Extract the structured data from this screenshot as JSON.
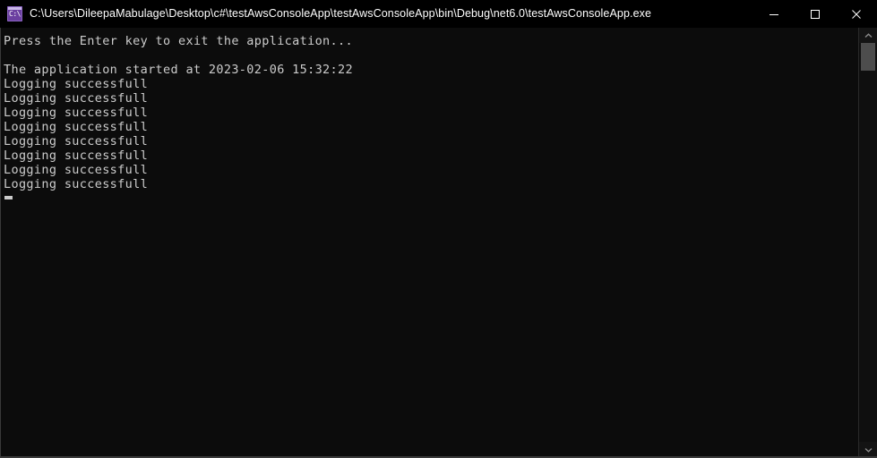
{
  "window": {
    "title": "C:\\Users\\DileepaMabulage\\Desktop\\c#\\testAwsConsoleApp\\testAwsConsoleApp\\bin\\Debug\\net6.0\\testAwsConsoleApp.exe",
    "icon_name": "console-app-icon",
    "icon_prompt_text": "C:\\",
    "background_color": "#0c0c0c",
    "titlebar_color": "#000000",
    "text_color": "#cccccc"
  },
  "controls": {
    "minimize_label": "Minimize",
    "maximize_label": "Maximize",
    "close_label": "Close"
  },
  "console": {
    "lines": [
      "Press the Enter key to exit the application...",
      "",
      "The application started at 2023-02-06 15:32:22",
      "Logging successfull",
      "Logging successfull",
      "Logging successfull",
      "Logging successfull",
      "Logging successfull",
      "Logging successfull",
      "Logging successfull",
      "Logging successfull"
    ],
    "cursor_visible": true,
    "timestamp": "2023-02-06 15:32:22",
    "log_message": "Logging successfull",
    "log_message_count": 8
  },
  "scrollbar": {
    "up_arrow_name": "scroll-up",
    "down_arrow_name": "scroll-down",
    "thumb_position_percent": 0,
    "thumb_size_percent": 7
  }
}
